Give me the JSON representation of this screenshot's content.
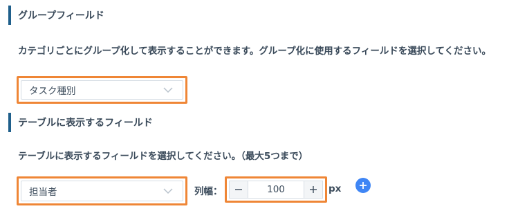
{
  "group_field": {
    "title": "グループフィールド",
    "description": "カテゴリごとにグループ化して表示することができます。グループ化に使用するフィールドを選択してください。",
    "select_value": "タスク種別"
  },
  "table_fields": {
    "title": "テーブルに表示するフィールド",
    "description": "テーブルに表示するフィールドを選択してください。（最大5つまで）",
    "rows": [
      {
        "field_value": "担当者",
        "width_label": "列幅：",
        "width_value": "100",
        "unit": "px"
      }
    ]
  },
  "colors": {
    "accent_border": "#1f5f8b",
    "highlight": "#ef8636",
    "add_button": "#3f86f5"
  },
  "icons": {
    "dropdown": "chevron-down-icon",
    "decrement": "minus-icon",
    "increment": "plus-icon",
    "add_row": "plus-circle-icon"
  }
}
